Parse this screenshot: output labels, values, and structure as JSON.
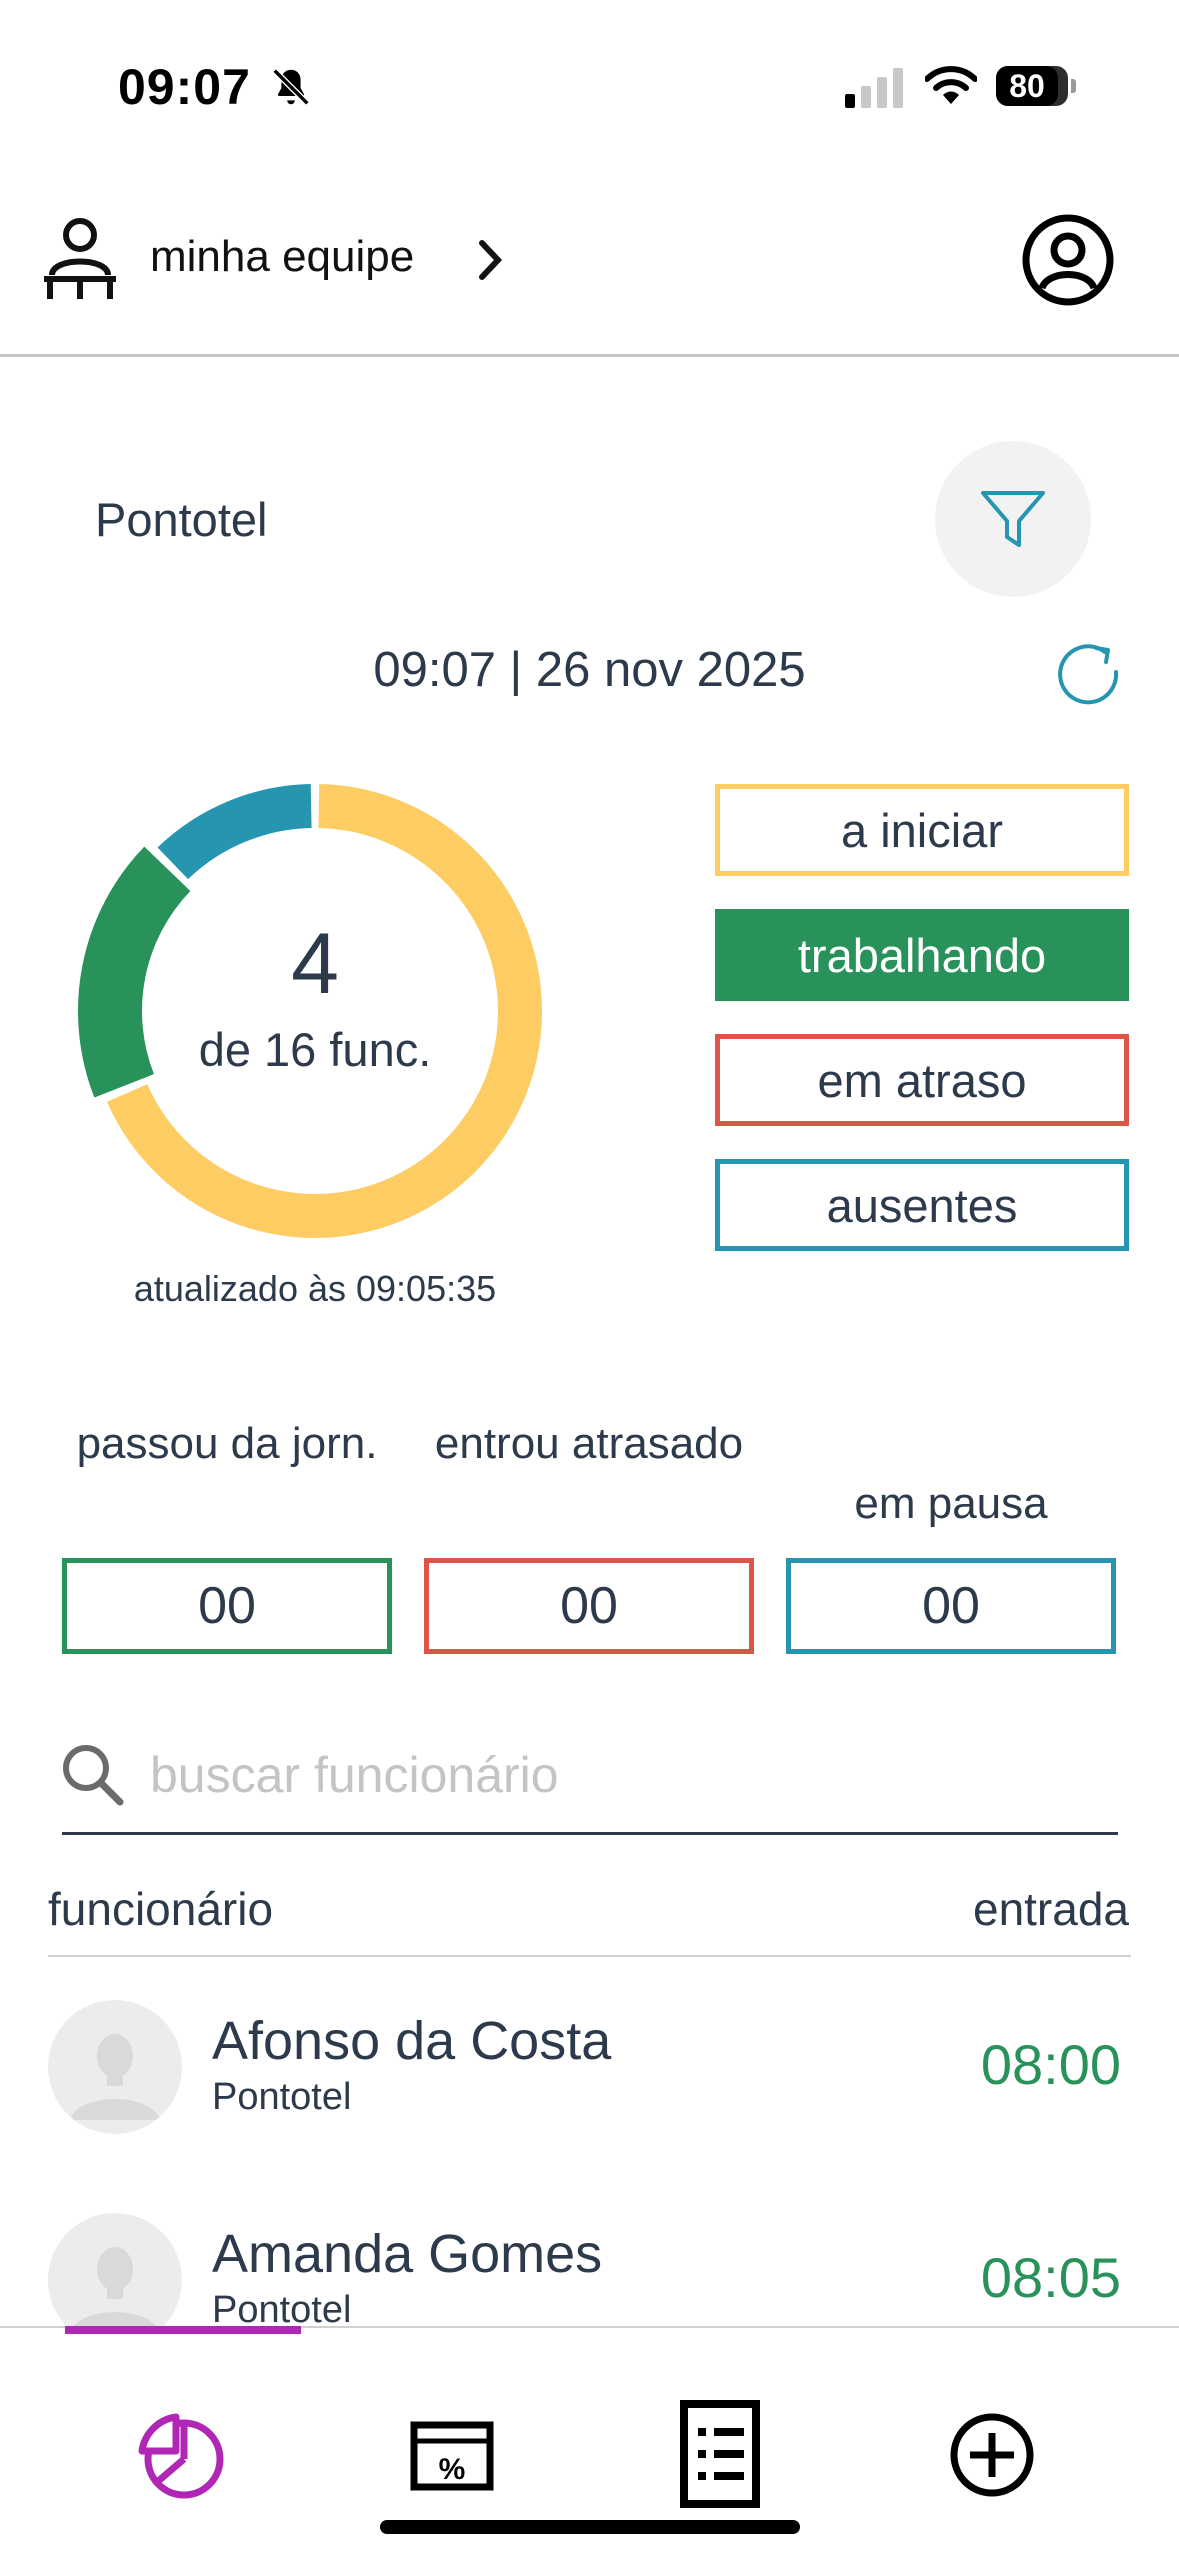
{
  "status_bar": {
    "time": "09:07",
    "battery": "80"
  },
  "header": {
    "team_label": "minha equipe"
  },
  "company": "Pontotel",
  "datetime": "09:07 | 26 nov 2025",
  "summary": {
    "count": "4",
    "subtitle": "de 16 func.",
    "updated": "atualizado às 09:05:35",
    "ring_segments": [
      {
        "status": "a iniciar",
        "fraction": 0.6875,
        "color": "#fdcd63"
      },
      {
        "status": "trabalhando",
        "fraction": 0.1875,
        "color": "#28925a"
      },
      {
        "status": "ausentes",
        "fraction": 0.125,
        "color": "#2595b0"
      }
    ]
  },
  "filters": [
    {
      "label": "a iniciar",
      "color": "#fdcd63",
      "selected": false
    },
    {
      "label": "trabalhando",
      "color": "#28925a",
      "selected": true
    },
    {
      "label": "em atraso",
      "color": "#dd5449",
      "selected": false
    },
    {
      "label": "ausentes",
      "color": "#2595b0",
      "selected": false
    }
  ],
  "counters": [
    {
      "label": "passou da jorn.",
      "value": "00",
      "color": "#28925a"
    },
    {
      "label": "entrou atrasado",
      "value": "00",
      "color": "#dd5449"
    },
    {
      "label": "em pausa",
      "value": "00",
      "color": "#2595b0"
    }
  ],
  "search": {
    "placeholder": "buscar funcionário"
  },
  "table": {
    "col_employee": "funcionário",
    "col_entry": "entrada",
    "rows": [
      {
        "name": "Afonso da Costa",
        "company": "Pontotel",
        "entry": "08:00"
      },
      {
        "name": "Amanda Gomes",
        "company": "Pontotel",
        "entry": "08:05"
      }
    ]
  },
  "nav": {
    "items": [
      "dashboard-icon",
      "percent-calendar-icon",
      "list-icon",
      "add-icon"
    ],
    "active": "dashboard-icon",
    "accent": "#b026b5"
  }
}
